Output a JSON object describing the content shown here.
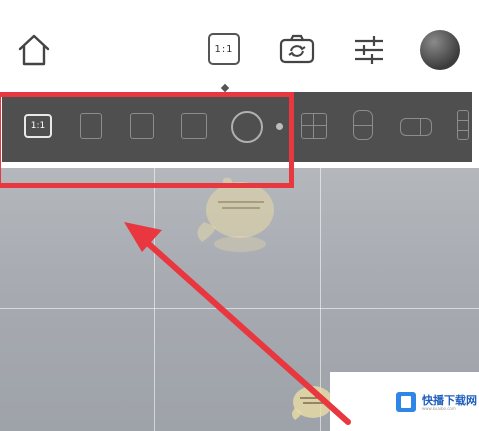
{
  "toolbar": {
    "home_icon": "home-icon",
    "ratio_label": "1:1",
    "switch_icon": "camera-switch-icon",
    "settings_icon": "sliders-icon",
    "avatar_icon": "avatar"
  },
  "aspect_strip": {
    "options": [
      {
        "label": "1:1",
        "icon": "ratio-1-1-icon",
        "selected": true
      },
      {
        "label": "",
        "icon": "ratio-portrait-a-icon"
      },
      {
        "label": "",
        "icon": "ratio-portrait-b-icon"
      },
      {
        "label": "",
        "icon": "ratio-square-c-icon"
      },
      {
        "label": "",
        "icon": "circle-icon"
      },
      {
        "label": "",
        "icon": "dot-separator-icon"
      },
      {
        "label": "",
        "icon": "grid-four-icon"
      },
      {
        "label": "",
        "icon": "split-vertical-icon"
      },
      {
        "label": "",
        "icon": "split-horizontal-icon"
      },
      {
        "label": "",
        "icon": "split-three-icon"
      }
    ]
  },
  "watermark": {
    "brand_text": "快播下载网",
    "brand_sub": "www.kuaibo.com"
  },
  "colors": {
    "highlight": "#e8373e",
    "strip_bg": "#4f4f4f",
    "brand_blue": "#2f86e6"
  }
}
